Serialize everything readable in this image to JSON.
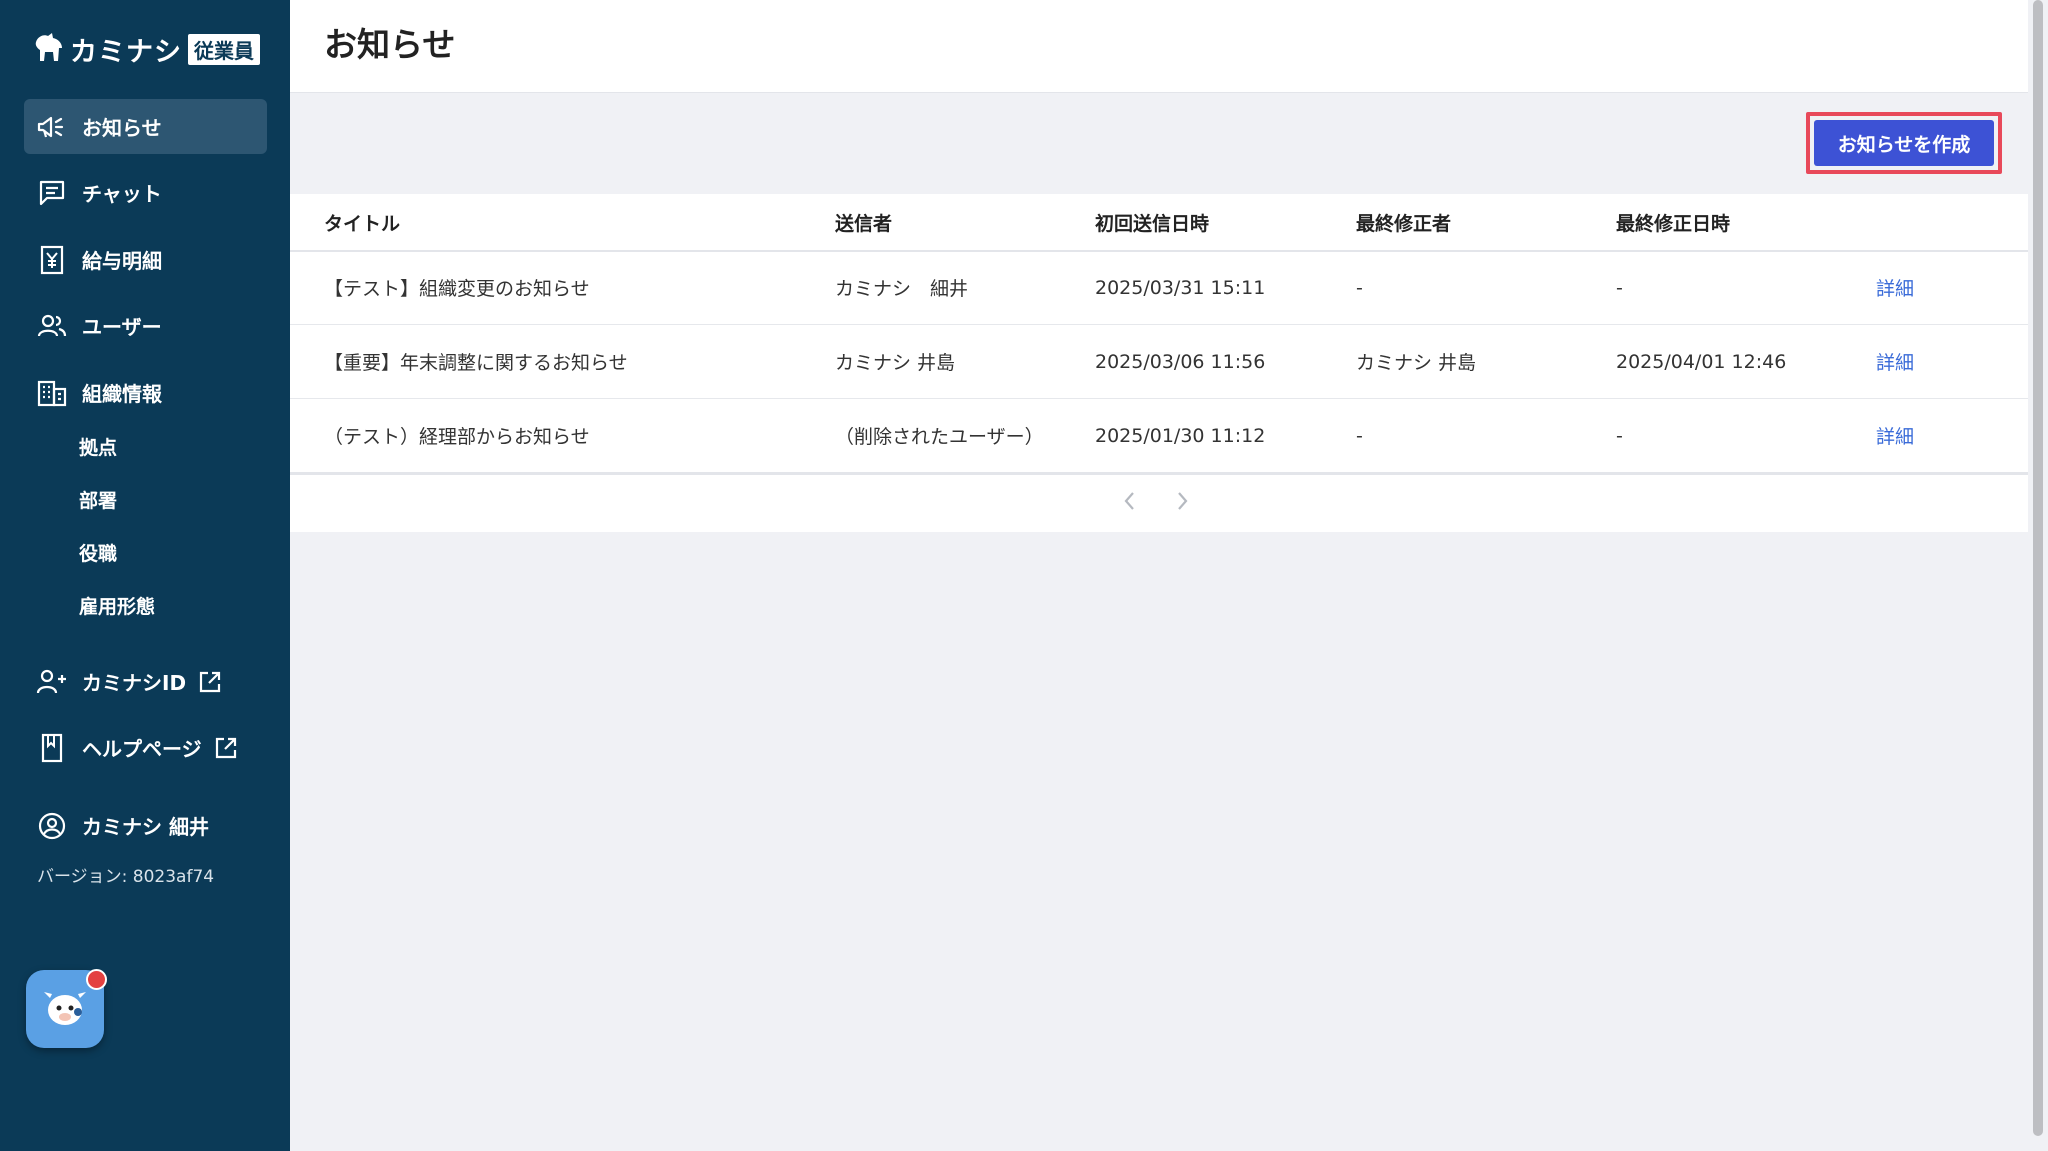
{
  "app": {
    "logo_text": "カミナシ",
    "logo_badge": "従業員"
  },
  "sidebar": {
    "items": [
      {
        "label": "お知らせ",
        "icon": "megaphone-icon",
        "active": true
      },
      {
        "label": "チャット",
        "icon": "chat-icon"
      },
      {
        "label": "給与明細",
        "icon": "payslip-icon"
      },
      {
        "label": "ユーザー",
        "icon": "users-icon"
      },
      {
        "label": "組織情報",
        "icon": "building-icon"
      }
    ],
    "org_sub_items": [
      "拠点",
      "部署",
      "役職",
      "雇用形態"
    ],
    "external_links": [
      {
        "label": "カミナシID",
        "icon": "user-plus-icon"
      },
      {
        "label": "ヘルプページ",
        "icon": "book-icon"
      }
    ],
    "user_name": "カミナシ 細井",
    "version": "バージョン: 8023af74"
  },
  "header": {
    "title": "お知らせ"
  },
  "toolbar": {
    "create_label": "お知らせを作成"
  },
  "table": {
    "columns": [
      "タイトル",
      "送信者",
      "初回送信日時",
      "最終修正者",
      "最終修正日時"
    ],
    "rows": [
      {
        "title": "【テスト】組織変更のお知らせ",
        "sender": "カミナシ　細井",
        "first_sent": "2025/03/31 15:11",
        "last_editor": "-",
        "last_edited": "-",
        "action": "詳細"
      },
      {
        "title": "【重要】年末調整に関するお知らせ",
        "sender": "カミナシ 井島",
        "first_sent": "2025/03/06 11:56",
        "last_editor": "カミナシ 井島",
        "last_edited": "2025/04/01 12:46",
        "action": "詳細"
      },
      {
        "title": "（テスト）経理部からお知らせ",
        "sender": "（削除されたユーザー）",
        "first_sent": "2025/01/30 11:12",
        "last_editor": "-",
        "last_edited": "-",
        "action": "詳細"
      }
    ]
  },
  "colors": {
    "sidebar_bg": "#0b3a57",
    "sidebar_active": "#2d5672",
    "primary_button": "#3d52d5",
    "highlight_border": "#e8495a",
    "link": "#3a6bd8"
  }
}
